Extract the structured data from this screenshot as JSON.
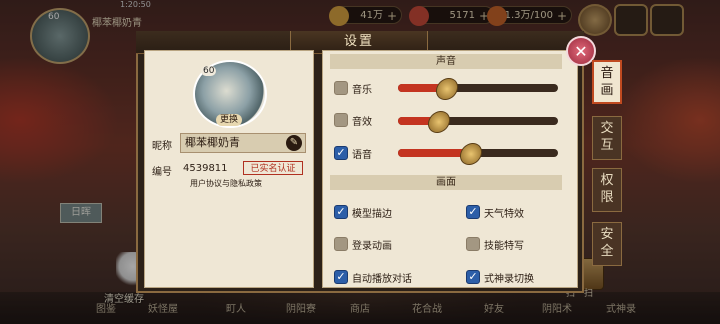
{
  "top": {
    "player_name": "椰苯椰奶青",
    "player_level": "60",
    "clock": "1:20:50",
    "resources": [
      {
        "name": "coins",
        "value": "41万",
        "icon": "coin-icon",
        "color": "#d9a441"
      },
      {
        "name": "jade",
        "value": "5171",
        "icon": "jade-icon",
        "color": "#c94a3a"
      },
      {
        "name": "stamina",
        "value": "1.3万/100",
        "icon": "stamina-icon",
        "color": "#c8642a"
      }
    ]
  },
  "modal": {
    "title": "设置",
    "profile": {
      "avatar_level": "60",
      "change_label": "更换",
      "nickname_label": "昵称",
      "nickname": "椰苯椰奶青",
      "id_label": "编号",
      "id": "4539811",
      "verified_badge": "已实名认证",
      "policy_link": "用户协议与隐私政策"
    },
    "sound": {
      "header": "声音",
      "items": [
        {
          "label": "音乐",
          "checked": false,
          "level": 0.3
        },
        {
          "label": "音效",
          "checked": false,
          "level": 0.25
        },
        {
          "label": "语音",
          "checked": true,
          "level": 0.45
        }
      ]
    },
    "display": {
      "header": "画面",
      "options": [
        {
          "label": "模型描边",
          "checked": true
        },
        {
          "label": "天气特效",
          "checked": true
        },
        {
          "label": "登录动画",
          "checked": false
        },
        {
          "label": "技能特写",
          "checked": false
        },
        {
          "label": "自动播放对话",
          "checked": true
        },
        {
          "label": "式神录切换",
          "checked": true
        }
      ]
    },
    "tabs": [
      {
        "label": "音\n画",
        "active": true
      },
      {
        "label": "交\n互",
        "active": false
      },
      {
        "label": "权\n限",
        "active": false
      },
      {
        "label": "安\n全",
        "active": false
      }
    ]
  },
  "scene": {
    "daylight_label": "日晖",
    "clear_cache": "清空缓存",
    "scan": "扫一扫",
    "bottom_nav": [
      "图鉴",
      "妖怪屋",
      "町人",
      "阴阳寮",
      "商店",
      "花合战",
      "好友",
      "阴阳术",
      "式神录"
    ]
  }
}
